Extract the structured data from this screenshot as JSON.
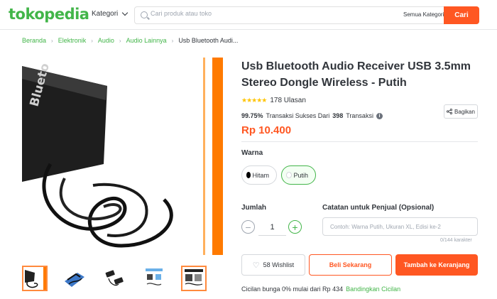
{
  "header": {
    "logo": "tokopedia",
    "category_label": "Kategori",
    "search_placeholder": "Cari produk atau toko",
    "search_category": "Semua Kategori",
    "search_button": "Cari"
  },
  "breadcrumb": {
    "items": [
      "Beranda",
      "Elektronik",
      "Audio",
      "Audio Lainnya"
    ],
    "current": "Usb Bluetooth Audi..."
  },
  "product": {
    "title": "Usb Bluetooth Audio Receiver USB 3.5mm Stereo Dongle Wireless - Putih",
    "stars": "★★★★★",
    "rating_value": 5,
    "reviews": "178 Ulasan",
    "success_rate": "99.75%",
    "success_text": "Transaksi Sukses Dari",
    "transactions": "398",
    "transactions_label": "Transaksi",
    "price": "Rp 10.400",
    "share_label": "Bagikan"
  },
  "variants": {
    "label": "Warna",
    "options": [
      {
        "label": "Hitam",
        "color": "#000000"
      },
      {
        "label": "Putih",
        "color": "#ffffff",
        "selected": true
      }
    ]
  },
  "quantity": {
    "label": "Jumlah",
    "value": "1",
    "minus": "−",
    "plus": "+"
  },
  "notes": {
    "label": "Catatan untuk Penjual (Opsional)",
    "placeholder": "Contoh: Warna Putih, Ukuran XL, Edisi ke-2",
    "char_count": "0/144 karakter"
  },
  "actions": {
    "wishlist": "58 Wishlist",
    "buy_now": "Beli Sekarang",
    "add_to_cart": "Tambah ke Keranjang"
  },
  "installment": {
    "text": "Cicilan bunga 0% mulai dari Rp 434",
    "link": "Bandingkan Cicilan"
  },
  "colors": {
    "brand_green": "#42b549",
    "accent_orange": "#ff5722",
    "star_yellow": "#ffc400"
  }
}
